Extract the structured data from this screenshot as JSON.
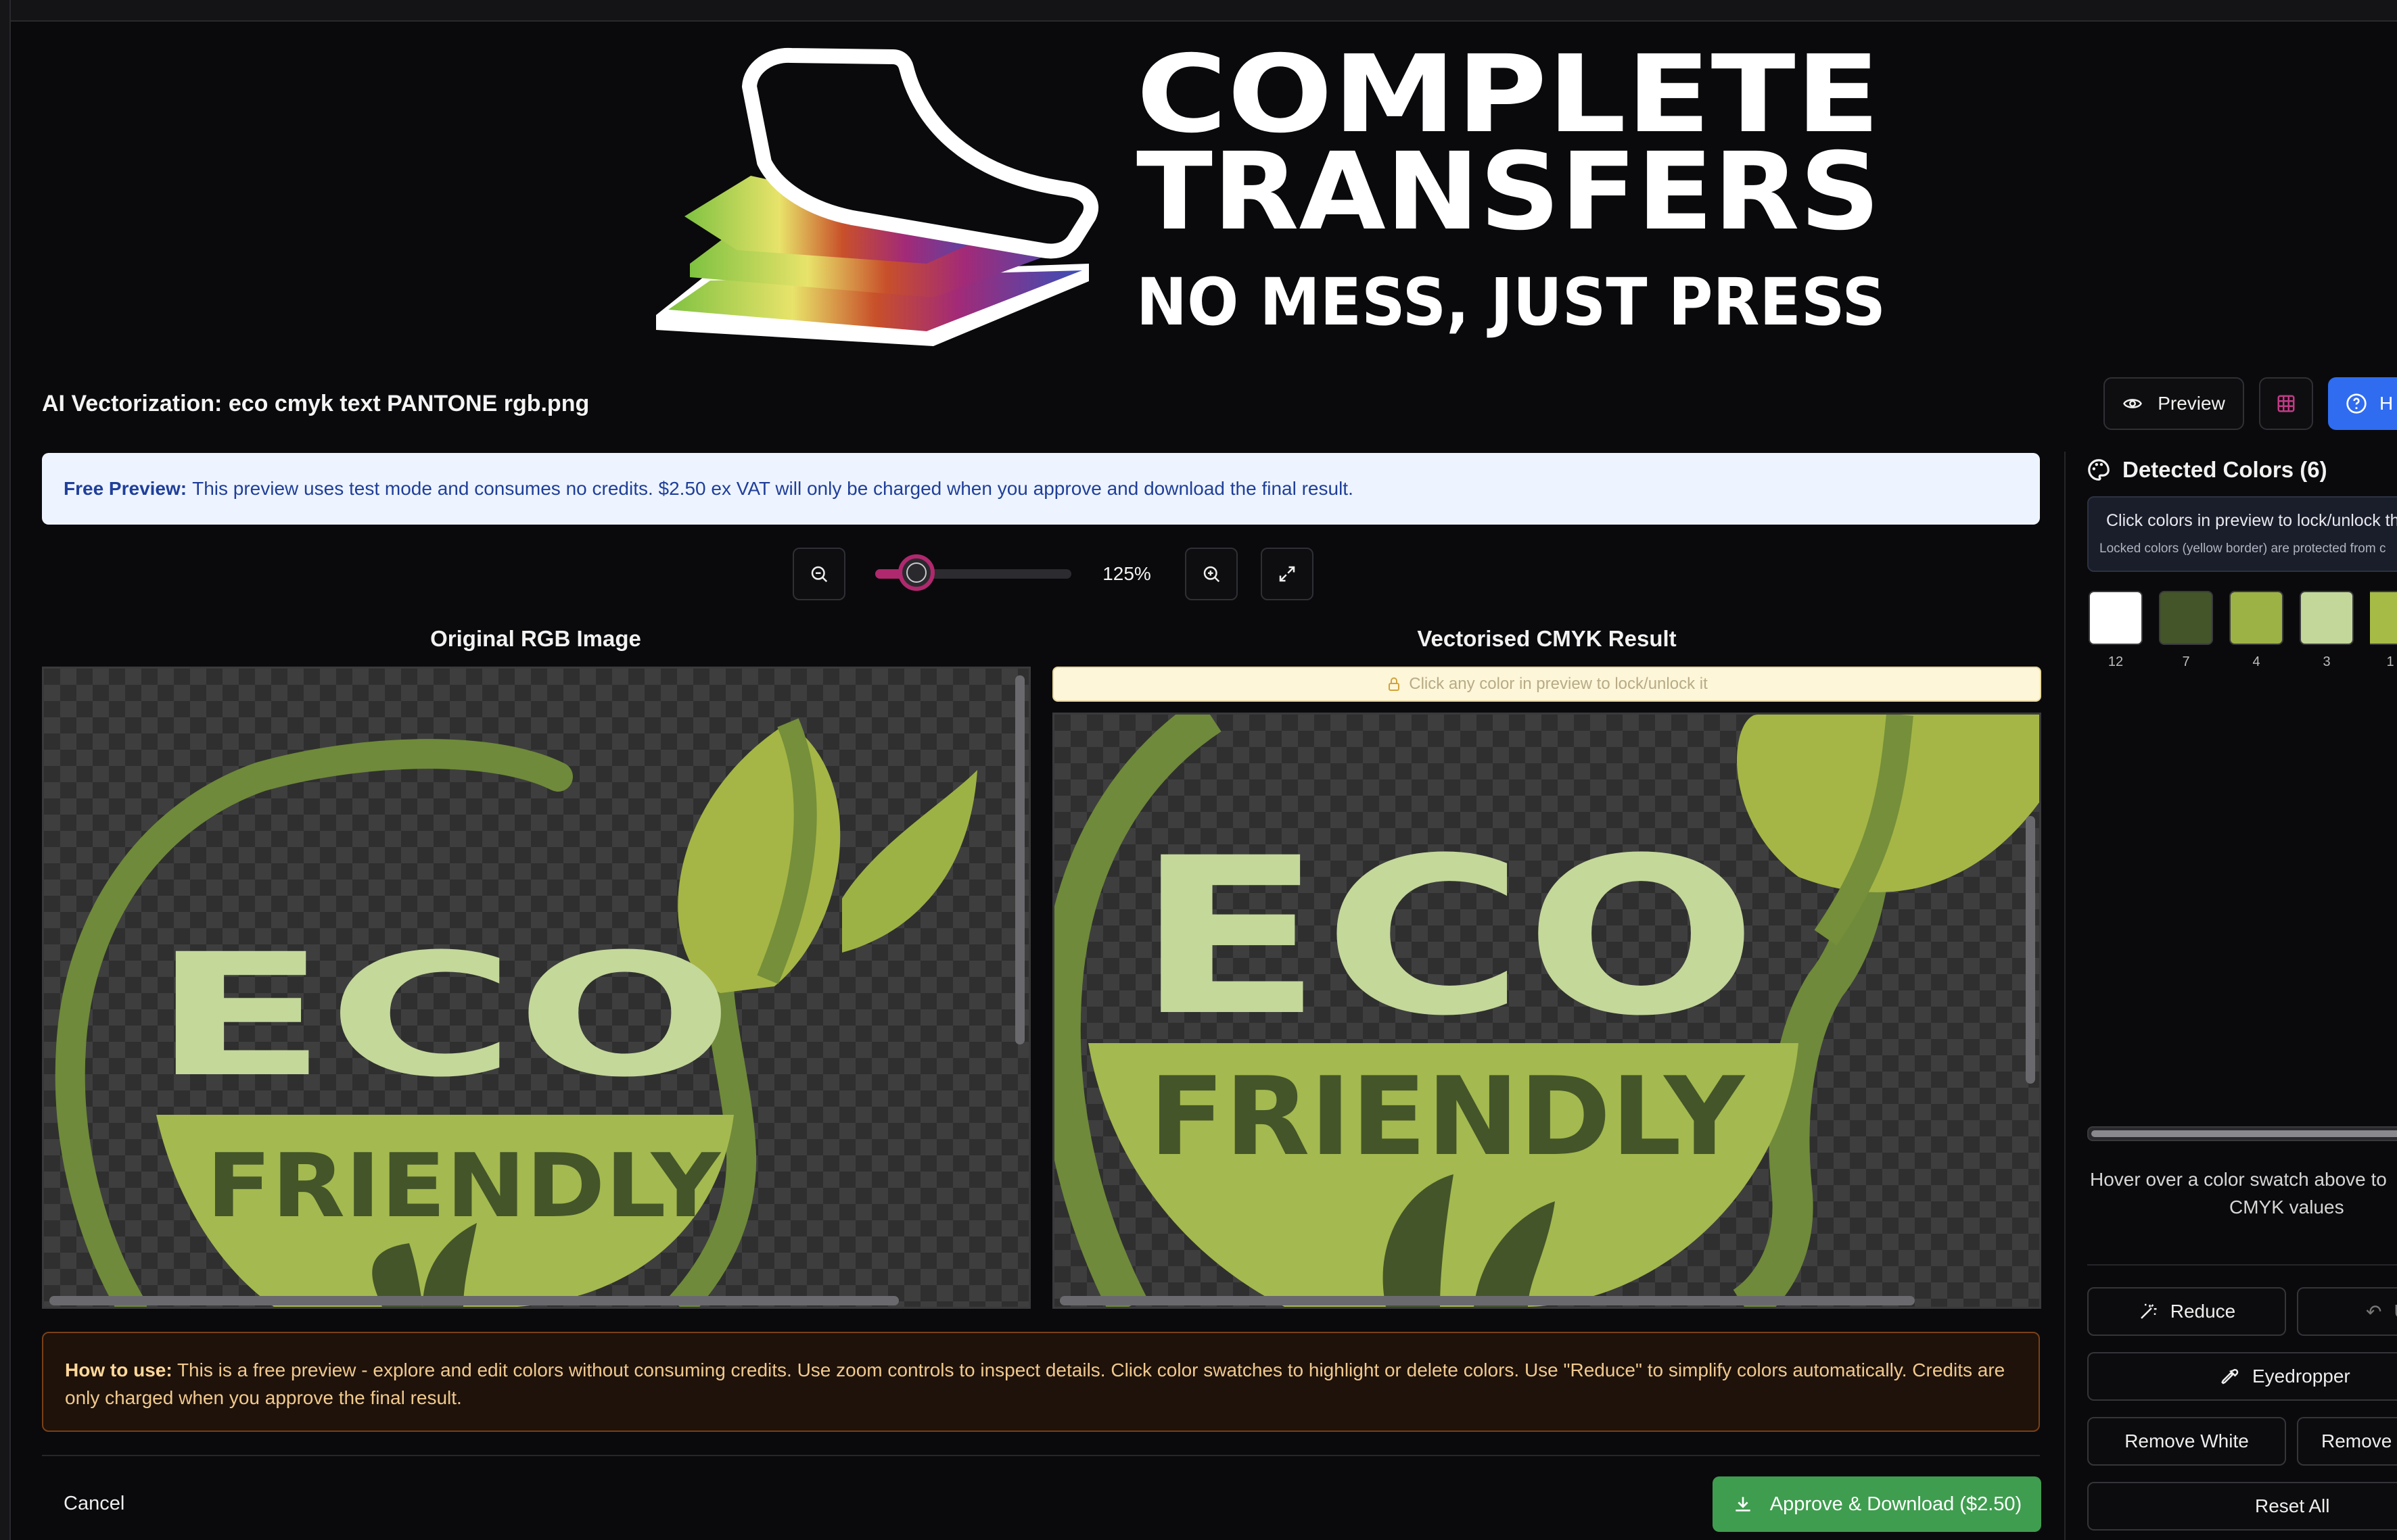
{
  "window": {
    "title": "AI Vectorization: eco cmyk text PANTONE rgb.png"
  },
  "logo": {
    "line1": "COMPLETE",
    "line2": "TRANSFERS",
    "tagline": "NO MESS, JUST PRESS"
  },
  "toolbar": {
    "preview_label": "Preview",
    "help_label": "H"
  },
  "notice": {
    "bold": "Free Preview:",
    "text": "This preview uses test mode and consumes no credits. $2.50 ex VAT will only be charged when you approve and download the final result."
  },
  "zoom": {
    "value": 125,
    "label": "125%"
  },
  "original": {
    "heading": "Original RGB Image"
  },
  "result": {
    "heading": "Vectorised CMYK Result",
    "lock_hint": "Click any color in preview to lock/unlock it"
  },
  "artwork": {
    "word1": "ECO",
    "word2": "FRIENDLY"
  },
  "howto": {
    "bold": "How to use:",
    "text": "This is a free preview - explore and edit colors without consuming credits. Use zoom controls to inspect details. Click color swatches to highlight or delete colors. Use \"Reduce\" to simplify colors automatically. Credits are only charged when you approve the final result."
  },
  "footer": {
    "cancel_label": "Cancel",
    "approve_label": "Approve & Download ($2.50)"
  },
  "colors_panel": {
    "title": "Detected Colors (6)",
    "info_line1": "Click colors in preview to lock/unlock th",
    "info_line2": "Locked colors (yellow border) are protected from c",
    "swatches": [
      {
        "color": "#ffffff",
        "count": "12"
      },
      {
        "color": "#44552a",
        "count": "7"
      },
      {
        "color": "#9db245",
        "count": "4"
      },
      {
        "color": "#c3d79a",
        "count": "3"
      },
      {
        "color": "#a5bb46",
        "count": "1"
      }
    ],
    "hover_line1": "Hover over a color swatch above to",
    "hover_line2": "CMYK values",
    "reduce_label": "Reduce",
    "undo_label": "U",
    "eyedropper_label": "Eyedropper",
    "remove_white_label": "Remove White",
    "remove_label": "Remove",
    "reset_label": "Reset All"
  },
  "colors": {
    "accent_blue": "#2f6cf0",
    "approve_green": "#3f9d4f",
    "slider_accent": "#b0286e"
  }
}
